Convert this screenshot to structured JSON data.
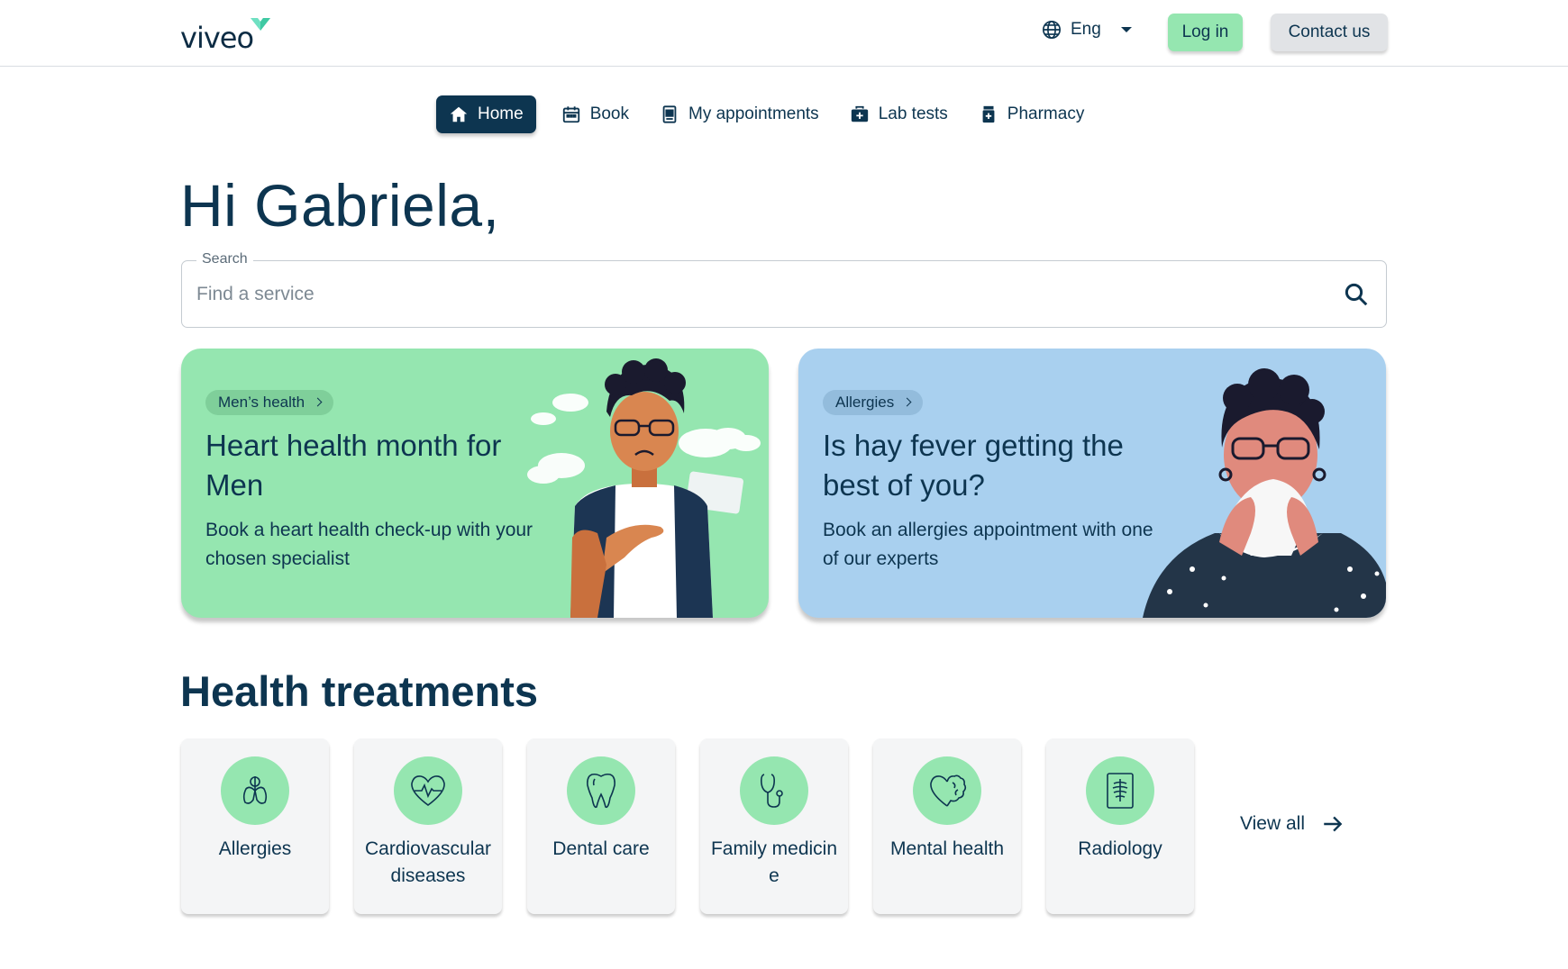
{
  "header": {
    "logo_text": "viveo",
    "language": "Eng",
    "login_label": "Log in",
    "contact_label": "Contact us"
  },
  "nav": {
    "items": [
      {
        "label": "Home",
        "icon": "home-icon",
        "active": true
      },
      {
        "label": "Book",
        "icon": "calendar-icon"
      },
      {
        "label": "My appointments",
        "icon": "clipboard-icon"
      },
      {
        "label": "Lab tests",
        "icon": "medical-kit-icon"
      },
      {
        "label": "Pharmacy",
        "icon": "pill-bottle-icon"
      }
    ]
  },
  "greeting": "Hi Gabriela,",
  "search": {
    "legend": "Search",
    "placeholder": "Find a service"
  },
  "cards": [
    {
      "chip": "Men’s health",
      "title": "Heart health month for Men",
      "description": "Book a heart health check-up with your chosen specialist",
      "color": "#95e6b0"
    },
    {
      "chip": "Allergies",
      "title": "Is hay fever getting the best of you?",
      "description": "Book an allergies appointment with one of our experts",
      "color": "#a9d0ef"
    }
  ],
  "treatments": {
    "title": "Health treatments",
    "items": [
      {
        "label": "Allergies",
        "icon": "lungs-icon"
      },
      {
        "label": "Cardiovascular diseases",
        "icon": "heart-pulse-icon"
      },
      {
        "label": "Dental care",
        "icon": "tooth-icon"
      },
      {
        "label": "Family medicine",
        "icon": "stethoscope-icon"
      },
      {
        "label": "Mental health",
        "icon": "brain-heart-icon"
      },
      {
        "label": "Radiology",
        "icon": "xray-icon"
      }
    ],
    "view_all": "View all"
  },
  "colors": {
    "primary": "#0d3550",
    "accent_green": "#95e6b0",
    "accent_blue": "#a9d0ef"
  }
}
